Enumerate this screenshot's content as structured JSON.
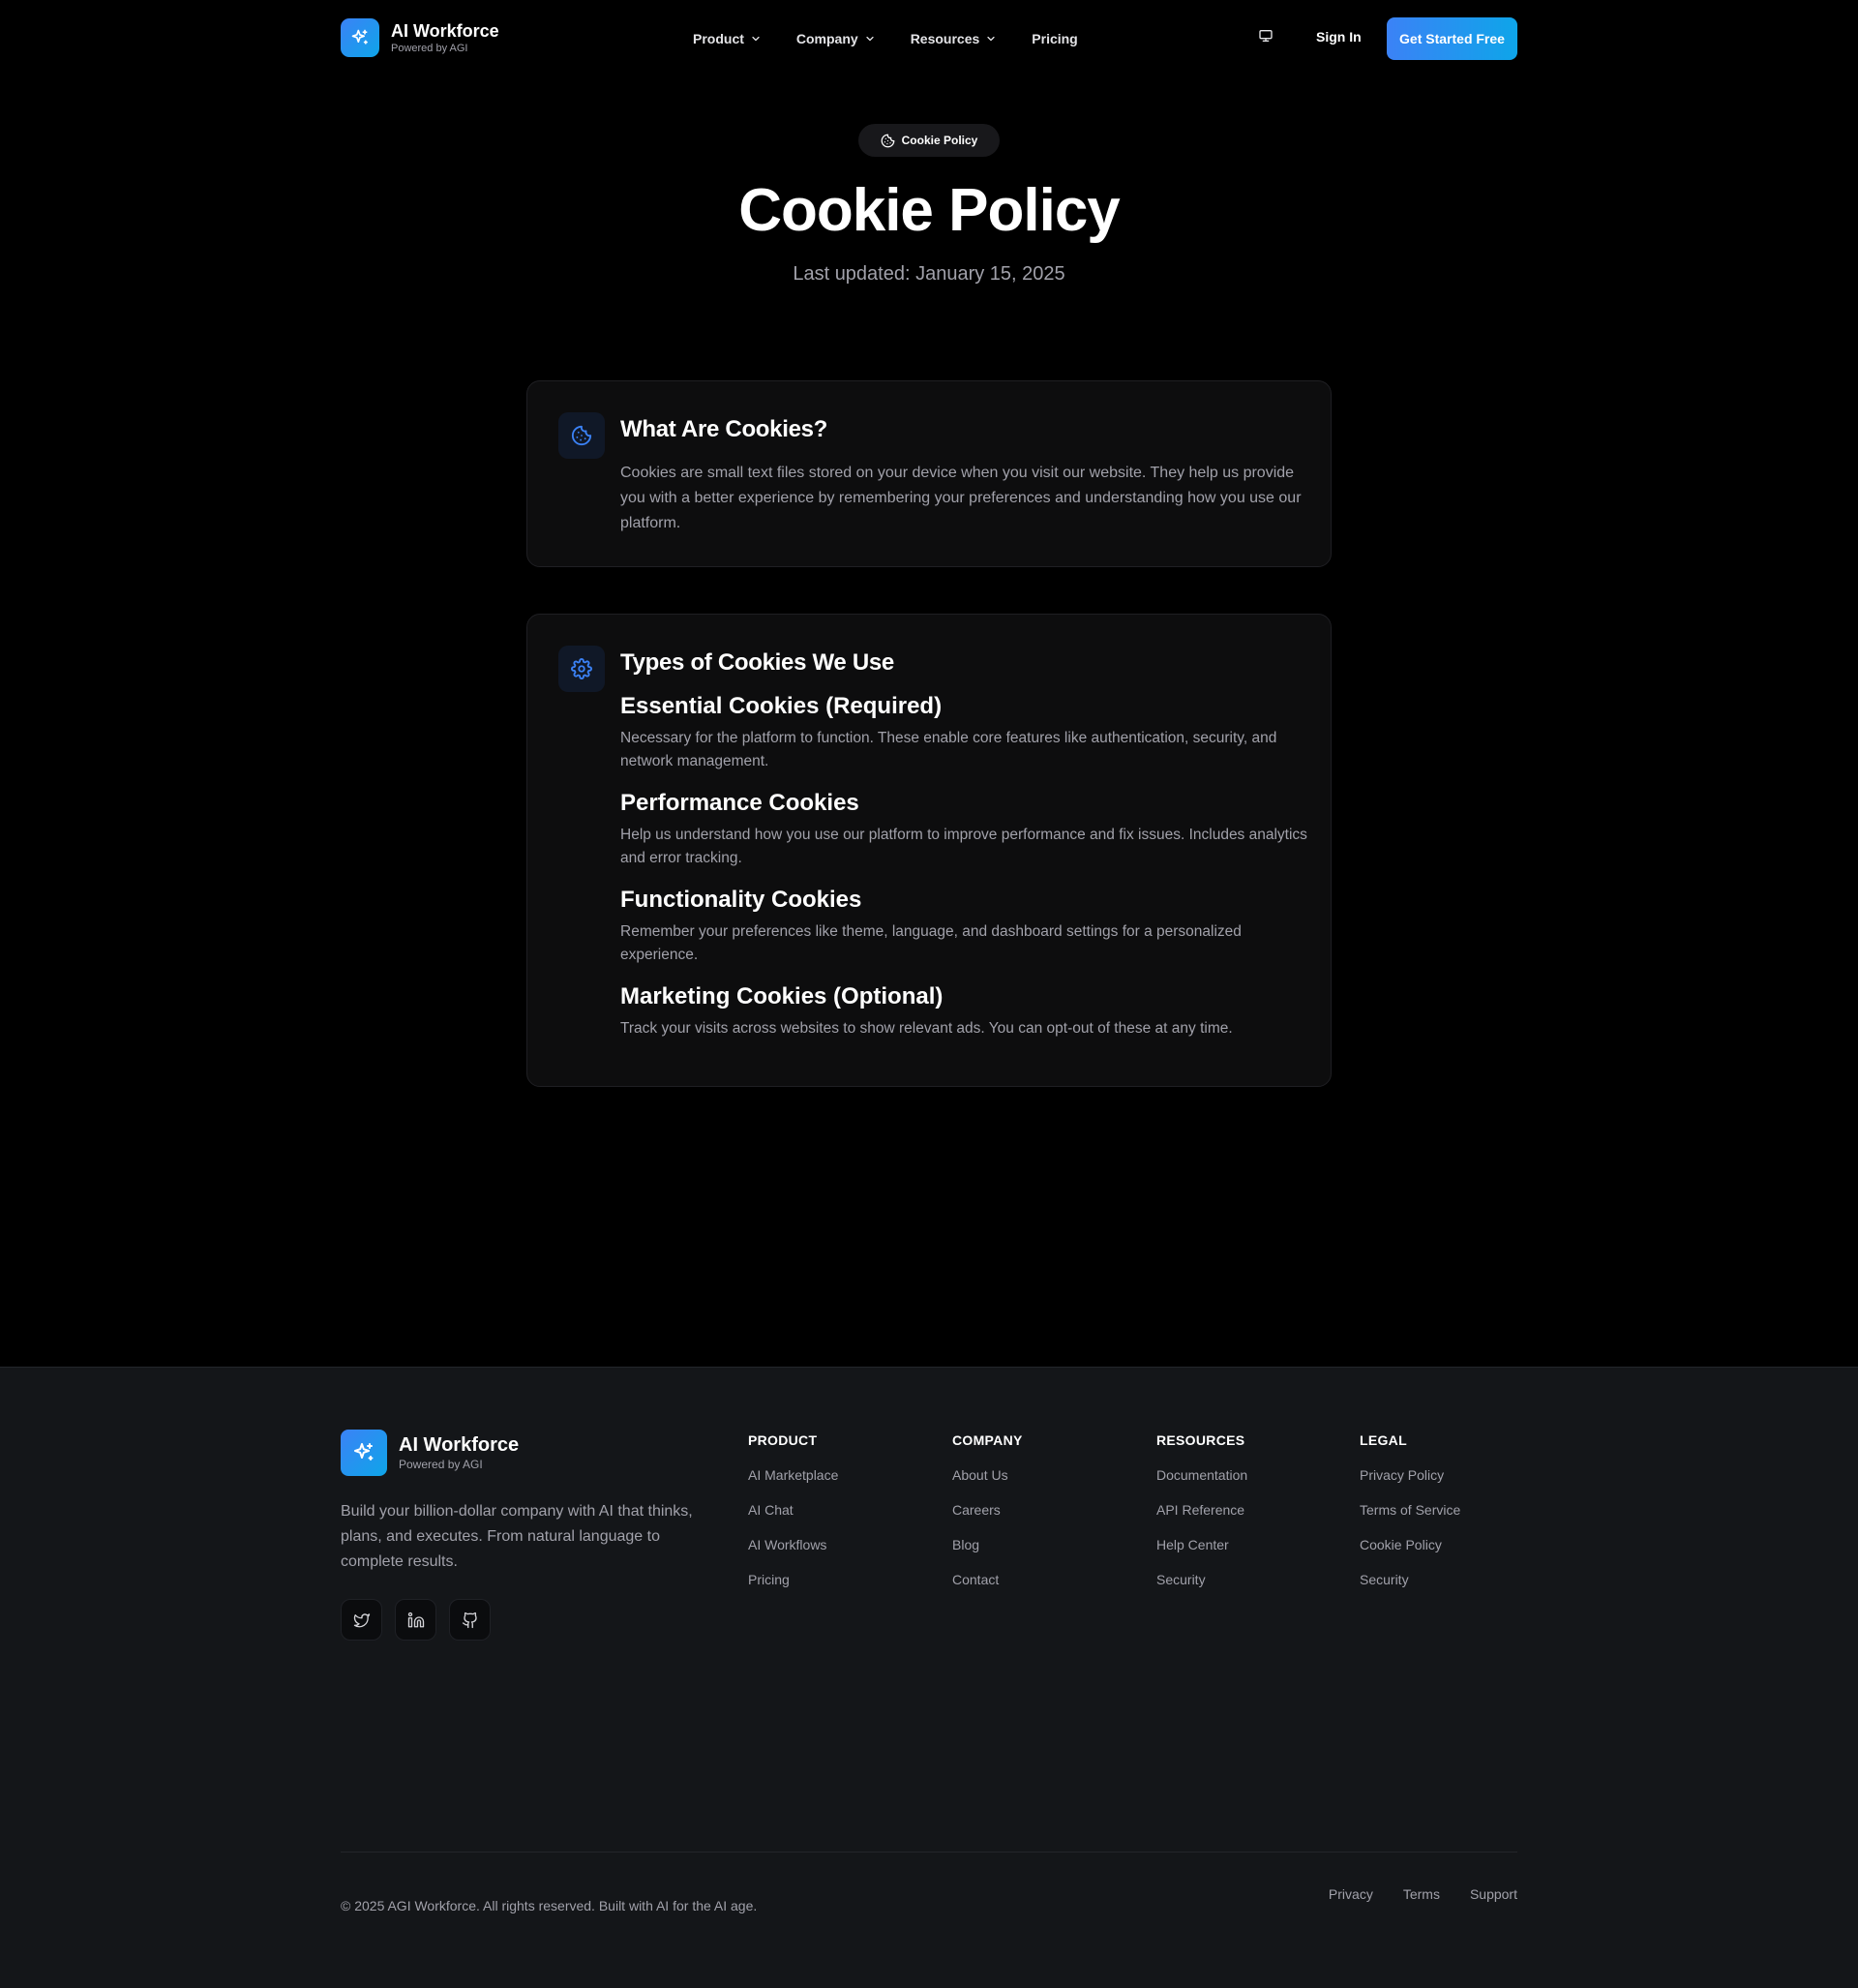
{
  "header": {
    "brand_name": "AI Workforce",
    "brand_sub": "Powered by AGI",
    "nav": [
      {
        "label": "Product",
        "has_dropdown": true
      },
      {
        "label": "Company",
        "has_dropdown": true
      },
      {
        "label": "Resources",
        "has_dropdown": true
      },
      {
        "label": "Pricing",
        "has_dropdown": false
      }
    ],
    "theme_icon": "monitor-icon",
    "sign_in": "Sign In",
    "cta": "Get Started Free"
  },
  "hero": {
    "badge": "Cookie Policy",
    "title": "Cookie Policy",
    "updated": "Last updated: January 15, 2025"
  },
  "sections": [
    {
      "icon": "cookie-icon",
      "title": "What Are Cookies?",
      "text": "Cookies are small text files stored on your device when you visit our website. They help us provide you with a better experience by remembering your preferences and understanding how you use our platform."
    },
    {
      "icon": "gear-icon",
      "title": "Types of Cookies We Use",
      "items": [
        {
          "title": "Essential Cookies (Required)",
          "text": "Necessary for the platform to function. These enable core features like authentication, security, and network management."
        },
        {
          "title": "Performance Cookies",
          "text": "Help us understand how you use our platform to improve performance and fix issues. Includes analytics and error tracking."
        },
        {
          "title": "Functionality Cookies",
          "text": "Remember your preferences like theme, language, and dashboard settings for a personalized experience."
        },
        {
          "title": "Marketing Cookies (Optional)",
          "text": "Track your visits across websites to show relevant ads. You can opt-out of these at any time."
        }
      ]
    }
  ],
  "footer": {
    "brand_name": "AI Workforce",
    "brand_sub": "Powered by AGI",
    "description": "Build your billion-dollar company with AI that thinks, plans, and executes. From natural language to complete results.",
    "social": [
      "twitter-icon",
      "linkedin-icon",
      "github-icon"
    ],
    "columns": [
      {
        "title": "PRODUCT",
        "links": [
          "AI Marketplace",
          "AI Chat",
          "AI Workflows",
          "Pricing"
        ]
      },
      {
        "title": "COMPANY",
        "links": [
          "About Us",
          "Careers",
          "Blog",
          "Contact"
        ]
      },
      {
        "title": "RESOURCES",
        "links": [
          "Documentation",
          "API Reference",
          "Help Center",
          "Security"
        ]
      },
      {
        "title": "LEGAL",
        "links": [
          "Privacy Policy",
          "Terms of Service",
          "Cookie Policy",
          "Security"
        ]
      }
    ],
    "copyright": "© 2025 AGI Workforce. All rights reserved. Built with AI for the AI age.",
    "bottom_links": [
      "Privacy",
      "Terms",
      "Support"
    ]
  },
  "colors": {
    "accent": "#3b82f6",
    "accent_end": "#0ea5e9",
    "background": "#000000",
    "footer_bg": "#141619",
    "card_bg": "#0d0d0e",
    "muted_text": "#a1a1aa"
  }
}
